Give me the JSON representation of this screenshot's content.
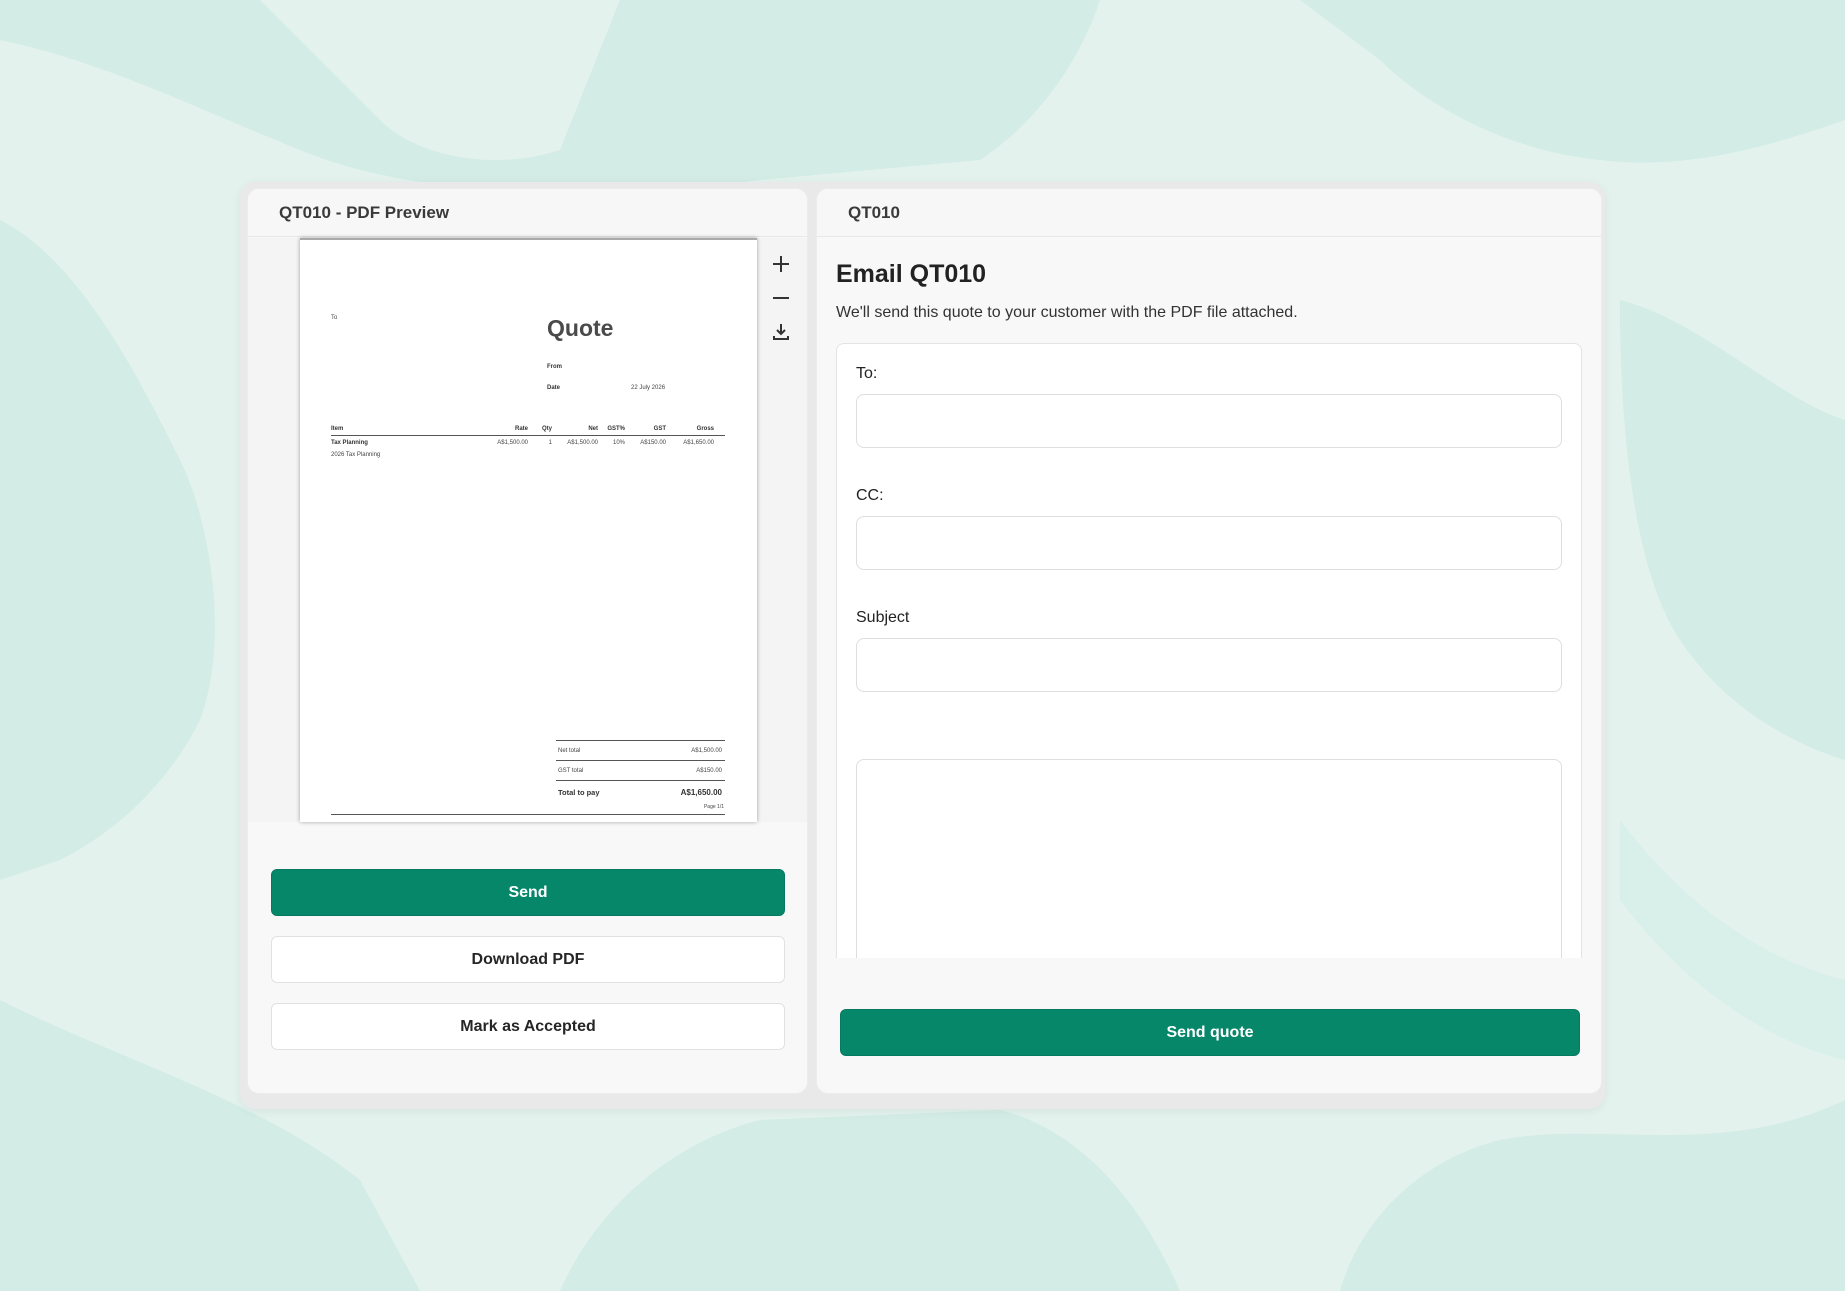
{
  "colors": {
    "accent": "#06876a",
    "background": "#e4f2ee"
  },
  "left_panel": {
    "title": "QT010 - PDF Preview",
    "tools": [
      "zoom-in-icon",
      "zoom-out-icon",
      "download-icon"
    ],
    "buttons": {
      "send": "Send",
      "download": "Download PDF",
      "accept": "Mark as Accepted"
    }
  },
  "pdf": {
    "to_label": "To",
    "title": "Quote",
    "from_label": "From",
    "date_label": "Date",
    "date_value": "22 July 2026",
    "columns": [
      "Item",
      "Rate",
      "Qty",
      "Net",
      "GST%",
      "GST",
      "Gross"
    ],
    "line_item": {
      "name": "Tax Planning",
      "description": "2026 Tax Planning",
      "rate": "A$1,500.00",
      "qty": "1",
      "net": "A$1,500.00",
      "gst_pct": "10%",
      "gst": "A$150.00",
      "gross": "A$1,650.00"
    },
    "totals": {
      "net_label": "Net total",
      "net_value": "A$1,500.00",
      "gst_label": "GST total",
      "gst_value": "A$150.00",
      "pay_label": "Total to pay",
      "pay_value": "A$1,650.00"
    },
    "page": "Page 1/1"
  },
  "right_panel": {
    "title": "QT010",
    "heading": "Email QT010",
    "subheading": "We'll send this quote to your customer with the PDF file attached.",
    "fields": {
      "to_label": "To:",
      "to_value": "",
      "cc_label": "CC:",
      "cc_value": "",
      "subject_label": "Subject",
      "subject_value": "",
      "message_value": ""
    },
    "send_button": "Send quote"
  }
}
